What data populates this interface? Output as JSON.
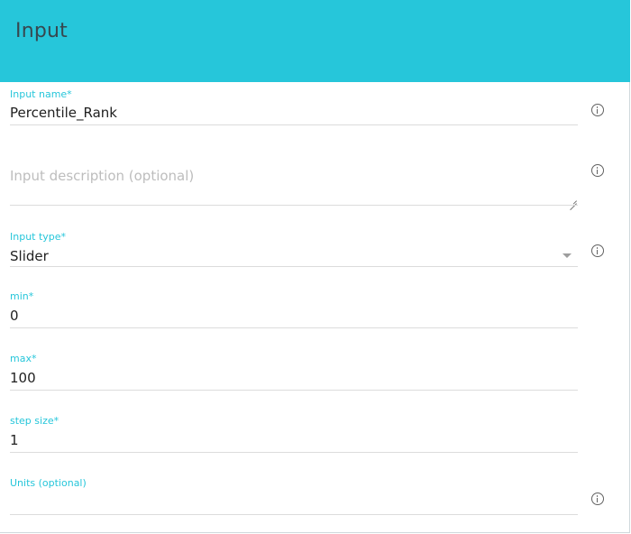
{
  "header": {
    "title": "Input"
  },
  "fields": {
    "input_name": {
      "label": "Input name*",
      "value": "Percentile_Rank"
    },
    "input_description": {
      "placeholder": "Input description (optional)",
      "value": ""
    },
    "input_type": {
      "label": "Input type*",
      "value": "Slider"
    },
    "min": {
      "label": "min*",
      "value": "0"
    },
    "max": {
      "label": "max*",
      "value": "100"
    },
    "step_size": {
      "label": "step size*",
      "value": "1"
    },
    "units": {
      "label": "Units (optional)",
      "value": ""
    }
  },
  "icons": {
    "info": "info-icon",
    "dropdown": "chevron-down-icon",
    "resize": "resize-handle-icon"
  },
  "colors": {
    "header_bg": "#26c6da",
    "label": "#26c6da",
    "text": "#212121",
    "placeholder": "#bdbdbd",
    "underline": "#dcdcdc"
  }
}
